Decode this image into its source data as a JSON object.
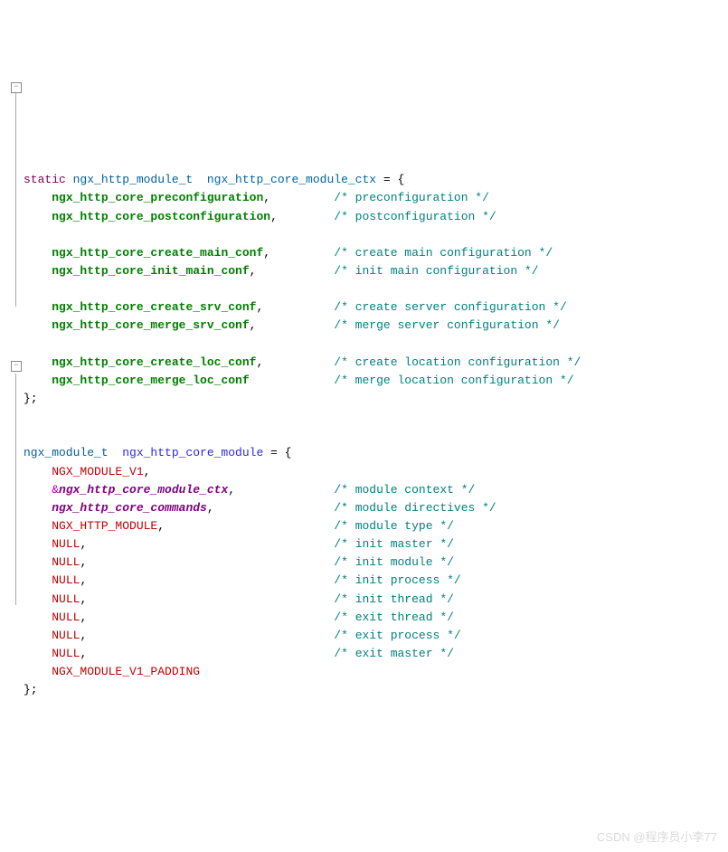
{
  "code": {
    "l1_kw": "static",
    "l1_type": " ngx_http_module_t  ",
    "l1_var": "ngx_http_core_module_ctx",
    "l1_tail": " = {",
    "l2_v": "ngx_http_core_preconfiguration",
    "l2_c": "/* preconfiguration */",
    "l3_v": "ngx_http_core_postconfiguration",
    "l3_c": "/* postconfiguration */",
    "l5_v": "ngx_http_core_create_main_conf",
    "l5_c": "/* create main configuration */",
    "l6_v": "ngx_http_core_init_main_conf",
    "l6_c": "/* init main configuration */",
    "l8_v": "ngx_http_core_create_srv_conf",
    "l8_c": "/* create server configuration */",
    "l9_v": "ngx_http_core_merge_srv_conf",
    "l9_c": "/* merge server configuration */",
    "l11_v": "ngx_http_core_create_loc_conf",
    "l11_c": "/* create location configuration */",
    "l12_v": "ngx_http_core_merge_loc_conf",
    "l12_c": "/* merge location configuration */",
    "close1": "};",
    "l16_type": "ngx_module_t  ",
    "l16_var": "ngx_http_core_module",
    "l16_tail": " = {",
    "l17_v": "NGX_MODULE_V1",
    "l18_amp": "&",
    "l18_v": "ngx_http_core_module_ctx",
    "l18_c": "/* module context */",
    "l19_v": "ngx_http_core_commands",
    "l19_c": "/* module directives */",
    "l20_v": "NGX_HTTP_MODULE",
    "l20_c": "/* module type */",
    "l21_v": "NULL",
    "l21_c": "/* init master */",
    "l22_v": "NULL",
    "l22_c": "/* init module */",
    "l23_v": "NULL",
    "l23_c": "/* init process */",
    "l24_v": "NULL",
    "l24_c": "/* init thread */",
    "l25_v": "NULL",
    "l25_c": "/* exit thread */",
    "l26_v": "NULL",
    "l26_c": "/* exit process */",
    "l27_v": "NULL",
    "l27_c": "/* exit master */",
    "l28_v": "NGX_MODULE_V1_PADDING",
    "close2": "};"
  },
  "watermark": "CSDN @程序员小李77"
}
